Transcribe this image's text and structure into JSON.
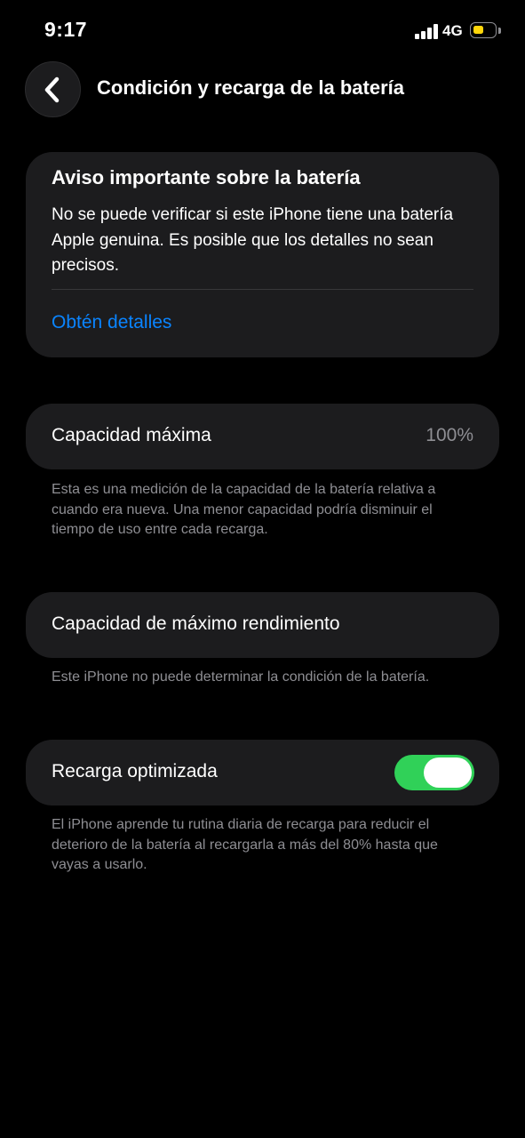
{
  "status_bar": {
    "time": "9:17",
    "network": "4G",
    "battery_level_fraction": 0.5,
    "battery_color": "#ffd60a"
  },
  "nav": {
    "back_icon": "chevron-left-icon",
    "title": "Condición y recarga de la batería"
  },
  "notice": {
    "title": "Aviso importante sobre la batería",
    "body": "No se puede verificar si este iPhone tiene una batería Apple genuina. Es posible que los detalles no sean precisos.",
    "link": "Obtén detalles"
  },
  "max_capacity": {
    "label": "Capacidad máxima",
    "value": "100%",
    "footnote": "Esta es una medición de la capacidad de la batería relativa a cuando era nueva. Una menor capacidad podría disminuir el tiempo de uso entre cada recarga."
  },
  "peak_performance": {
    "label": "Capacidad de máximo rendimiento",
    "footnote": "Este iPhone no puede determinar la condición de la batería."
  },
  "optimized_charging": {
    "label": "Recarga optimizada",
    "enabled": true,
    "toggle_color": "#30d158",
    "footnote": "El iPhone aprende tu rutina diaria de recarga para reducir el deterioro de la batería al recargarla a más del 80% hasta que vayas a usarlo."
  },
  "colors": {
    "link": "#0a84ff",
    "card_background": "#1c1c1e",
    "secondary_text": "#8e8e93"
  }
}
